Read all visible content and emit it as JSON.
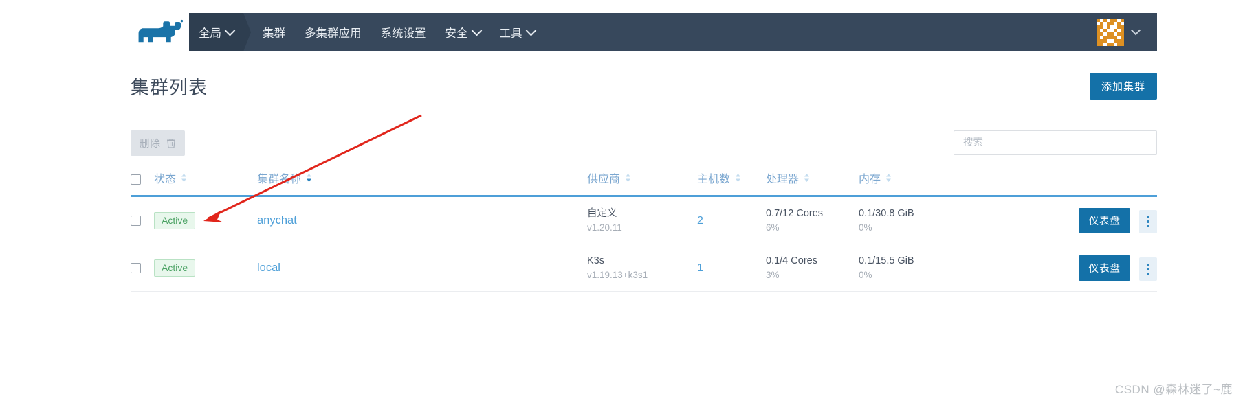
{
  "nav": {
    "logo_icon": "cow-logo-icon",
    "items": [
      {
        "label": "全局",
        "has_dropdown": true,
        "active": true,
        "name": "nav-item-global"
      },
      {
        "label": "集群",
        "has_dropdown": false,
        "active": false,
        "name": "nav-item-clusters"
      },
      {
        "label": "多集群应用",
        "has_dropdown": false,
        "active": false,
        "name": "nav-item-multicluster-apps"
      },
      {
        "label": "系统设置",
        "has_dropdown": false,
        "active": false,
        "name": "nav-item-settings"
      },
      {
        "label": "安全",
        "has_dropdown": true,
        "active": false,
        "name": "nav-item-security"
      },
      {
        "label": "工具",
        "has_dropdown": true,
        "active": false,
        "name": "nav-item-tools"
      }
    ],
    "avatar_icon": "user-avatar-identicon",
    "avatar_chevron_icon": "chevron-down-icon"
  },
  "header": {
    "title": "集群列表",
    "add_cluster_label": "添加集群"
  },
  "toolbar": {
    "delete_label": "删除",
    "delete_icon": "trash-icon",
    "search_placeholder": "搜索",
    "search_value": ""
  },
  "table": {
    "columns": [
      {
        "label": "状态",
        "sortable": true,
        "sort_state": "none",
        "name": "column-state"
      },
      {
        "label": "集群名称",
        "sortable": true,
        "sort_state": "asc",
        "name": "column-cluster-name"
      },
      {
        "label": "供应商",
        "sortable": true,
        "sort_state": "none",
        "name": "column-provider"
      },
      {
        "label": "主机数",
        "sortable": true,
        "sort_state": "none",
        "name": "column-host-count"
      },
      {
        "label": "处理器",
        "sortable": true,
        "sort_state": "none",
        "name": "column-cpu"
      },
      {
        "label": "内存",
        "sortable": true,
        "sort_state": "none",
        "name": "column-memory"
      }
    ],
    "rows": [
      {
        "status": "Active",
        "name": "anychat",
        "provider": "自定义",
        "version": "v1.20.11",
        "hosts": "2",
        "cpu": "0.7/12 Cores",
        "cpu_pct": "6%",
        "memory": "0.1/30.8 GiB",
        "memory_pct": "0%",
        "dashboard_label": "仪表盘"
      },
      {
        "status": "Active",
        "name": "local",
        "provider": "K3s",
        "version": "v1.19.13+k3s1",
        "hosts": "1",
        "cpu": "0.1/4 Cores",
        "cpu_pct": "3%",
        "memory": "0.1/15.5 GiB",
        "memory_pct": "0%",
        "dashboard_label": "仪表盘"
      }
    ]
  },
  "annotation": {
    "arrow_color": "#e1251b",
    "arrow_name": "red-pointer-arrow"
  },
  "watermark": {
    "text": "CSDN @森林迷了~鹿"
  },
  "colors": {
    "nav_bg": "#37485c",
    "nav_active_bg": "#2e3e50",
    "primary": "#1471a8",
    "link": "#4d9fd8",
    "header_underline": "#4d9fd8",
    "badge_green": "#4aa263"
  }
}
